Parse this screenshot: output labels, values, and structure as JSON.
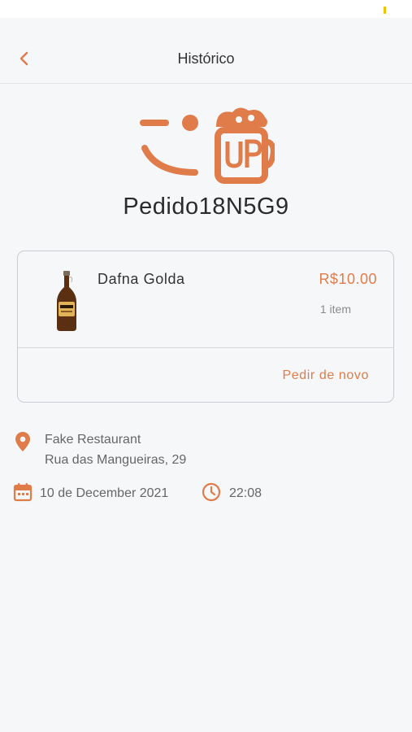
{
  "header": {
    "title": "Histórico"
  },
  "order": {
    "title": "Pedido18N5G9"
  },
  "item": {
    "name": "Dafna Golda",
    "price": "R$10.00",
    "quantity": "1 item",
    "reorder_label": "Pedir de novo"
  },
  "location": {
    "name": "Fake Restaurant",
    "address": "Rua das Mangueiras, 29"
  },
  "schedule": {
    "date": "10 de December 2021",
    "time": "22:08"
  },
  "colors": {
    "accent": "#e07b4a",
    "background": "#f6f7f9"
  },
  "icons": [
    "back-chevron-icon",
    "brand-logo-icon",
    "beer-bottle-image",
    "location-pin-icon",
    "calendar-icon",
    "clock-icon"
  ]
}
